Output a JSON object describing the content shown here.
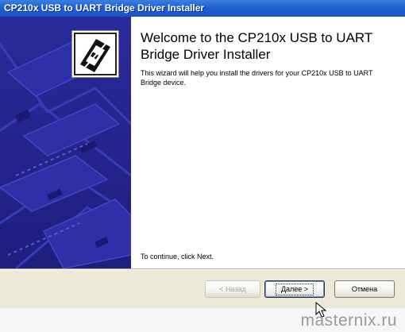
{
  "window": {
    "title": "CP210x USB to UART Bridge Driver Installer"
  },
  "content": {
    "welcome_title": "Welcome to the CP210x USB to UART Bridge Driver Installer",
    "description": "This wizard will help you install the drivers for your CP210x USB to UART Bridge device.",
    "continue_text": "To continue, click Next."
  },
  "buttons": {
    "back": "< Назад",
    "next": "Далее >",
    "cancel": "Отмена"
  },
  "watermark": "masternix.ru",
  "icons": {
    "installer": "usb-box-icon",
    "cursor": "mouse-pointer-icon"
  }
}
